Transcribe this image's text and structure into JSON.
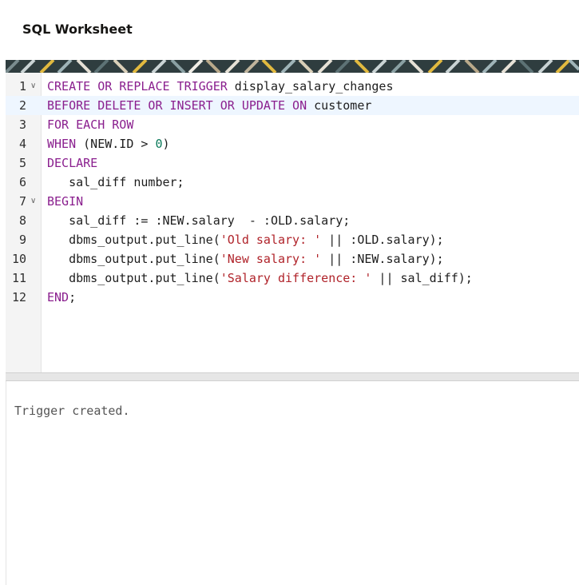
{
  "header": {
    "title": "SQL Worksheet"
  },
  "editor": {
    "lines": [
      {
        "number": "1",
        "segments": [
          [
            "kw",
            "CREATE OR REPLACE TRIGGER"
          ],
          [
            "txt",
            " display_salary_changes"
          ]
        ],
        "foldable": true
      },
      {
        "number": "2",
        "segments": [
          [
            "kw",
            "BEFORE DELETE OR INSERT OR UPDATE ON"
          ],
          [
            "txt",
            " customer"
          ]
        ],
        "active": true
      },
      {
        "number": "3",
        "segments": [
          [
            "kw",
            "FOR EACH ROW"
          ]
        ]
      },
      {
        "number": "4",
        "segments": [
          [
            "kw",
            "WHEN"
          ],
          [
            "txt",
            " (NEW.ID > "
          ],
          [
            "num",
            "0"
          ],
          [
            "txt",
            ")"
          ]
        ]
      },
      {
        "number": "5",
        "segments": [
          [
            "kw",
            "DECLARE"
          ]
        ]
      },
      {
        "number": "6",
        "segments": [
          [
            "txt",
            "   sal_diff number;"
          ]
        ]
      },
      {
        "number": "7",
        "segments": [
          [
            "kw",
            "BEGIN"
          ]
        ],
        "foldable": true
      },
      {
        "number": "8",
        "segments": [
          [
            "txt",
            "   sal_diff := :NEW.salary  - :OLD.salary;"
          ]
        ]
      },
      {
        "number": "9",
        "segments": [
          [
            "txt",
            "   dbms_output.put_line("
          ],
          [
            "str",
            "'Old salary: '"
          ],
          [
            "txt",
            " || :OLD.salary);"
          ]
        ]
      },
      {
        "number": "10",
        "segments": [
          [
            "txt",
            "   dbms_output.put_line("
          ],
          [
            "str",
            "'New salary: '"
          ],
          [
            "txt",
            " || :NEW.salary);"
          ]
        ]
      },
      {
        "number": "11",
        "segments": [
          [
            "txt",
            "   dbms_output.put_line("
          ],
          [
            "str",
            "'Salary difference: '"
          ],
          [
            "txt",
            " || sal_diff);"
          ]
        ]
      },
      {
        "number": "12",
        "segments": [
          [
            "kw",
            "END"
          ],
          [
            "txt",
            ";"
          ]
        ]
      }
    ],
    "fold_icon": "chevron-down-icon"
  },
  "output": {
    "text": "Trigger created."
  },
  "colors": {
    "keyword": "#8a1f8e",
    "string": "#b0232a",
    "number": "#0b7a5a",
    "active_line": "#eef6ff"
  }
}
